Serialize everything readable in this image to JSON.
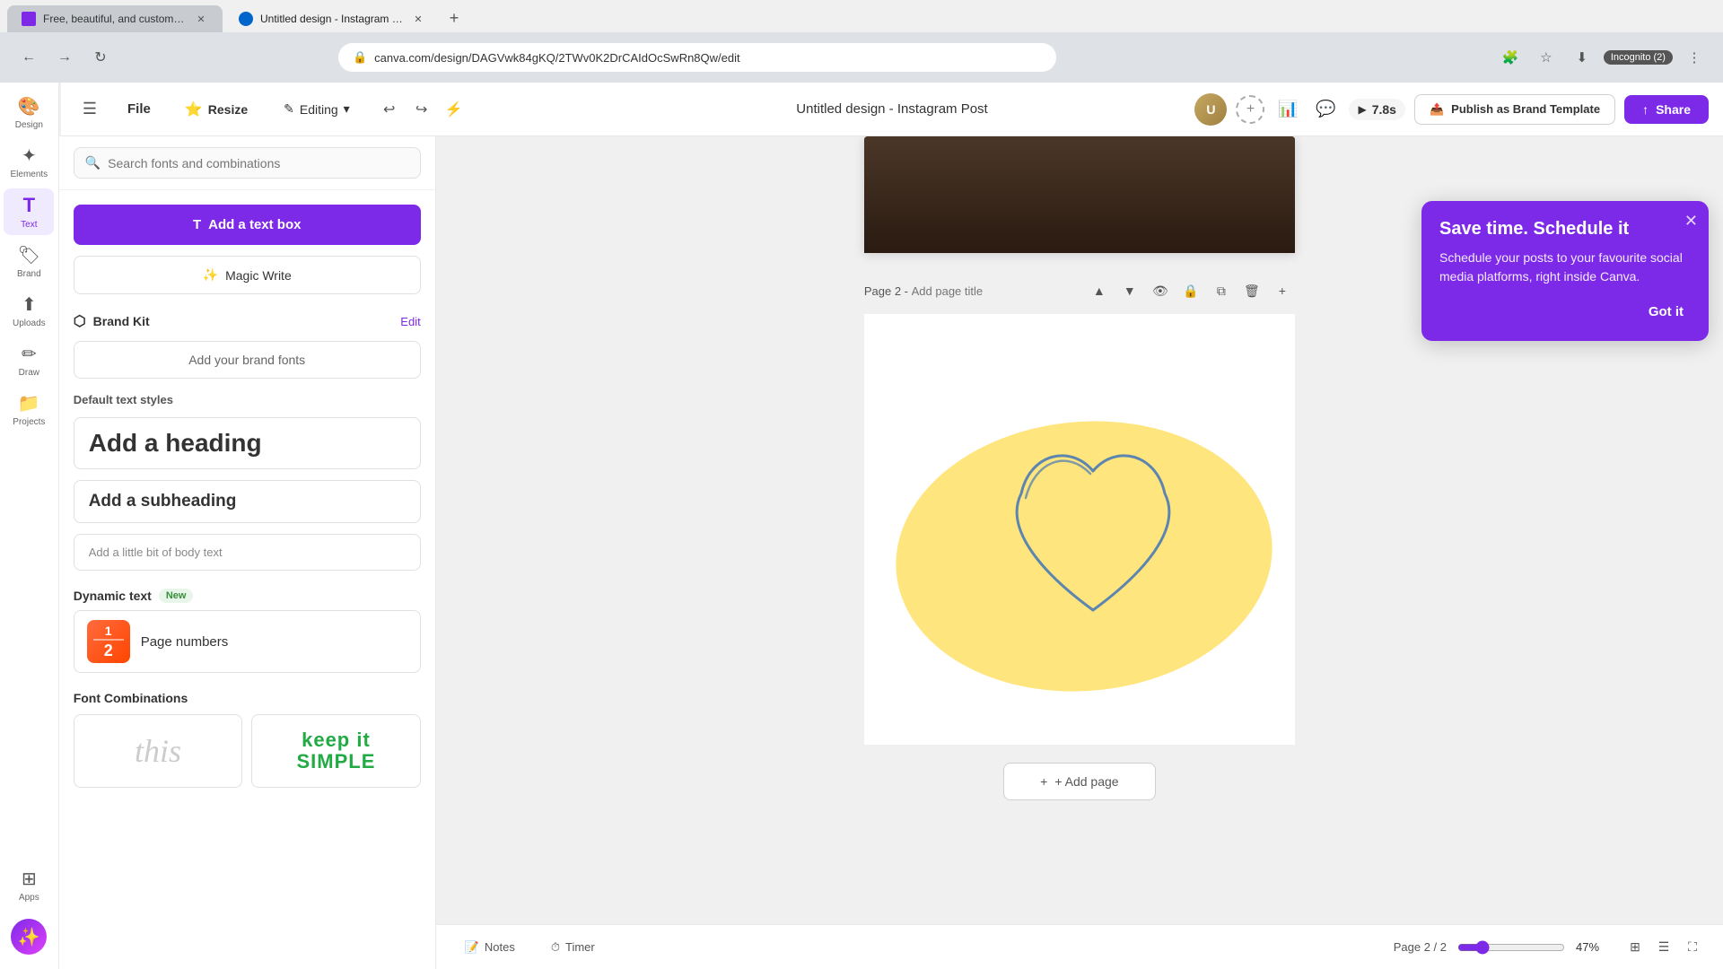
{
  "browser": {
    "tabs": [
      {
        "id": "tab1",
        "label": "Free, beautiful, and customizabl...",
        "favicon": "canva",
        "active": false
      },
      {
        "id": "tab2",
        "label": "Untitled design - Instagram Po...",
        "favicon": "design",
        "active": true
      }
    ],
    "address": "canva.com/design/DAGVwk84gKQ/2TWv0K2DrCAIdOcSwRn8Qw/edit",
    "nav_right": "Incognito (2)"
  },
  "topbar": {
    "file_label": "File",
    "resize_label": "Resize",
    "editing_label": "Editing",
    "title": "Untitled design - Instagram Post",
    "timer": "7.8s",
    "publish_label": "Publish as Brand Template",
    "share_label": "Share"
  },
  "text_panel": {
    "search_placeholder": "Search fonts and combinations",
    "add_textbox_label": "Add a text box",
    "magic_write_label": "Magic Write",
    "brand_kit": {
      "title": "Brand Kit",
      "edit_label": "Edit",
      "add_fonts_label": "Add your brand fonts"
    },
    "default_styles": {
      "label": "Default text styles",
      "heading": "Add a heading",
      "subheading": "Add a subheading",
      "body": "Add a little bit of body text"
    },
    "dynamic_text": {
      "label": "Dynamic text",
      "badge": "New",
      "page_numbers_label": "Page numbers"
    },
    "font_combinations": {
      "label": "Font Combinations",
      "items": [
        {
          "type": "italic",
          "text": "this"
        },
        {
          "type": "bold-green",
          "text": "keep it\nSIMPLE"
        }
      ]
    }
  },
  "canvas": {
    "page_label": "Page 2 -",
    "page_title_placeholder": "Add page title",
    "add_page_label": "+ Add page",
    "page_info": "Page 2 / 2",
    "zoom_value": "47%"
  },
  "bottom_bar": {
    "notes_label": "Notes",
    "timer_label": "Timer"
  },
  "popup": {
    "title": "Save time. Schedule it",
    "description": "Schedule your posts to your favourite social media platforms, right inside Canva.",
    "got_it_label": "Got it"
  },
  "sidebar": {
    "items": [
      {
        "id": "design",
        "label": "Design",
        "icon": "🎨"
      },
      {
        "id": "elements",
        "label": "Elements",
        "icon": "✦"
      },
      {
        "id": "text",
        "label": "Text",
        "icon": "T",
        "active": true
      },
      {
        "id": "brand",
        "label": "Brand",
        "icon": "🏷"
      },
      {
        "id": "uploads",
        "label": "Uploads",
        "icon": "⬆"
      },
      {
        "id": "draw",
        "label": "Draw",
        "icon": "✏"
      },
      {
        "id": "projects",
        "label": "Projects",
        "icon": "📁"
      },
      {
        "id": "apps",
        "label": "Apps",
        "icon": "⊞"
      }
    ]
  }
}
